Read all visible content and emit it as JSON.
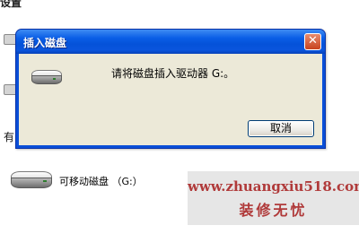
{
  "background": {
    "section_label": "设置",
    "cut_text_left": "有"
  },
  "removable_drive": {
    "label": "可移动磁盘 （G:）",
    "icon": "removable-drive-icon"
  },
  "watermark": {
    "url": "www.zhuangxiu518.com",
    "name": "装修无忧"
  },
  "dialog": {
    "title": "插入磁盘",
    "close_glyph": "✕",
    "message": "请将磁盘插入驱动器 G:。",
    "cancel_label": "取消",
    "icon": "drive-icon"
  },
  "colors": {
    "titlebar": "#0a55dd",
    "client": "#ece9d8",
    "close": "#c8421e",
    "watermark_text": "#b03a3a"
  }
}
